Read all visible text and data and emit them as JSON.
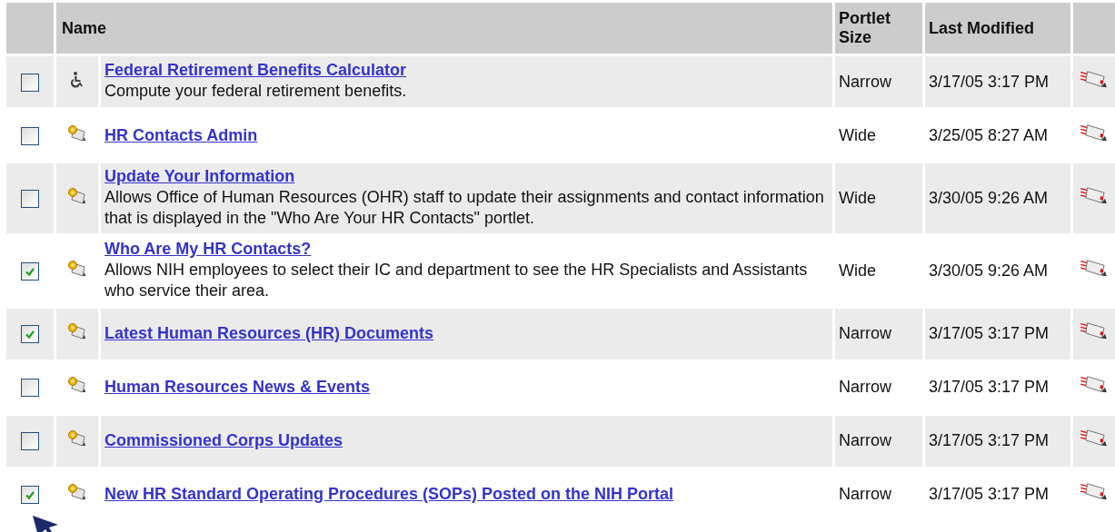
{
  "table": {
    "columns": [
      "Name",
      "Portlet Size",
      "Last Modified"
    ],
    "rows": [
      {
        "checked": false,
        "kind": "accessibility",
        "title": "Federal Retirement Benefits Calculator",
        "description": "Compute your federal retirement benefits.",
        "size": "Narrow",
        "modified": "3/17/05 3:17 PM"
      },
      {
        "checked": false,
        "kind": "portlet",
        "title": "HR Contacts Admin",
        "size": "Wide",
        "modified": "3/25/05 8:27 AM"
      },
      {
        "checked": false,
        "kind": "portlet",
        "title": "Update Your Information",
        "description": "Allows Office of Human Resources (OHR) staff to update their assignments and contact information that is displayed in the \"Who Are Your HR Contacts\" portlet.",
        "size": "Wide",
        "modified": "3/30/05 9:26 AM"
      },
      {
        "checked": true,
        "kind": "portlet",
        "title": "Who Are My HR Contacts?",
        "description": "Allows NIH employees to select their IC and department to see the HR Specialists and Assistants who service their area.",
        "size": "Wide",
        "modified": "3/30/05 9:26 AM"
      },
      {
        "checked": true,
        "kind": "portlet",
        "title": "Latest Human Resources (HR) Documents",
        "size": "Narrow",
        "modified": "3/17/05 3:17 PM"
      },
      {
        "checked": false,
        "kind": "portlet",
        "title": "Human Resources News & Events",
        "size": "Narrow",
        "modified": "3/17/05 3:17 PM"
      },
      {
        "checked": false,
        "kind": "portlet",
        "title": "Commissioned Corps Updates",
        "size": "Narrow",
        "modified": "3/17/05 3:17 PM"
      },
      {
        "checked": true,
        "kind": "portlet",
        "title": "New HR Standard Operating Procedures (SOPs) Posted on the NIH Portal",
        "size": "Narrow",
        "modified": "3/17/05 3:17 PM"
      }
    ]
  }
}
